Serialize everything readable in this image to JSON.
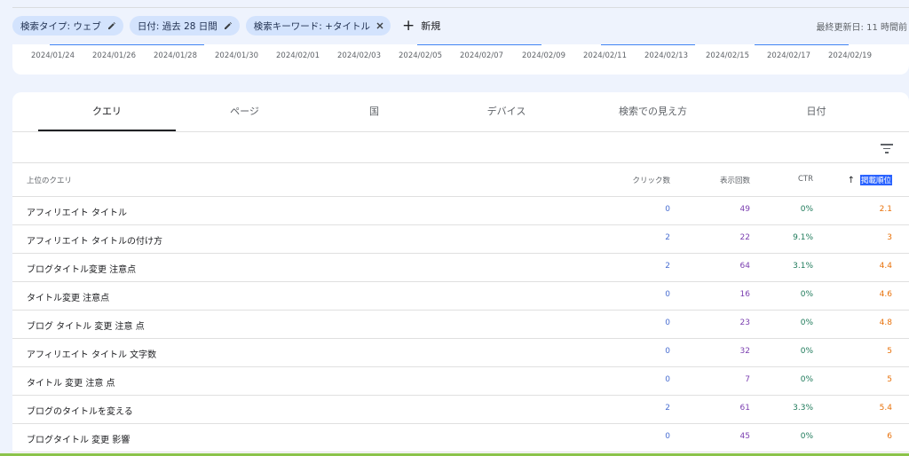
{
  "filters": {
    "chips": [
      {
        "label": "検索タイプ: ウェブ",
        "action": "edit"
      },
      {
        "label": "日付: 過去 28 日間",
        "action": "edit"
      },
      {
        "label": "検索キーワード: +タイトル",
        "action": "close"
      }
    ],
    "new_label": "新規",
    "last_updated": "最終更新日: 11 時間前"
  },
  "chart": {
    "x_ticks": [
      "2024/01/24",
      "2024/01/26",
      "2024/01/28",
      "2024/01/30",
      "2024/02/01",
      "2024/02/03",
      "2024/02/05",
      "2024/02/07",
      "2024/02/09",
      "2024/02/11",
      "2024/02/13",
      "2024/02/15",
      "2024/02/17",
      "2024/02/19"
    ],
    "line_color": "#4285f4"
  },
  "tabs": [
    {
      "label": "クエリ",
      "active": true
    },
    {
      "label": "ページ",
      "active": false
    },
    {
      "label": "国",
      "active": false
    },
    {
      "label": "デバイス",
      "active": false
    },
    {
      "label": "検索での見え方",
      "active": false
    },
    {
      "label": "日付",
      "active": false
    }
  ],
  "table": {
    "headers": {
      "query": "上位のクエリ",
      "clicks": "クリック数",
      "impressions": "表示回数",
      "ctr": "CTR",
      "position": "掲載順位"
    },
    "sort_icon": "arrow-up-icon",
    "rows": [
      {
        "query": "アフィリエイト タイトル",
        "clicks": "0",
        "impressions": "49",
        "ctr": "0%",
        "position": "2.1"
      },
      {
        "query": "アフィリエイト タイトルの付け方",
        "clicks": "2",
        "impressions": "22",
        "ctr": "9.1%",
        "position": "3"
      },
      {
        "query": "ブログタイトル変更 注意点",
        "clicks": "2",
        "impressions": "64",
        "ctr": "3.1%",
        "position": "4.4"
      },
      {
        "query": "タイトル変更 注意点",
        "clicks": "0",
        "impressions": "16",
        "ctr": "0%",
        "position": "4.6"
      },
      {
        "query": "ブログ タイトル 変更 注意 点",
        "clicks": "0",
        "impressions": "23",
        "ctr": "0%",
        "position": "4.8"
      },
      {
        "query": "アフィリエイト タイトル 文字数",
        "clicks": "0",
        "impressions": "32",
        "ctr": "0%",
        "position": "5"
      },
      {
        "query": "タイトル 変更 注意 点",
        "clicks": "0",
        "impressions": "7",
        "ctr": "0%",
        "position": "5"
      },
      {
        "query": "ブログのタイトルを変える",
        "clicks": "2",
        "impressions": "61",
        "ctr": "3.3%",
        "position": "5.4"
      },
      {
        "query": "ブログタイトル 変更 影響",
        "clicks": "0",
        "impressions": "45",
        "ctr": "0%",
        "position": "6"
      }
    ]
  },
  "colors": {
    "clicks": "#4a6fd2",
    "impressions": "#7b3fb0",
    "ctr": "#1e7a5a",
    "position": "#e8710a",
    "chip_bg": "#d3e3fd"
  }
}
